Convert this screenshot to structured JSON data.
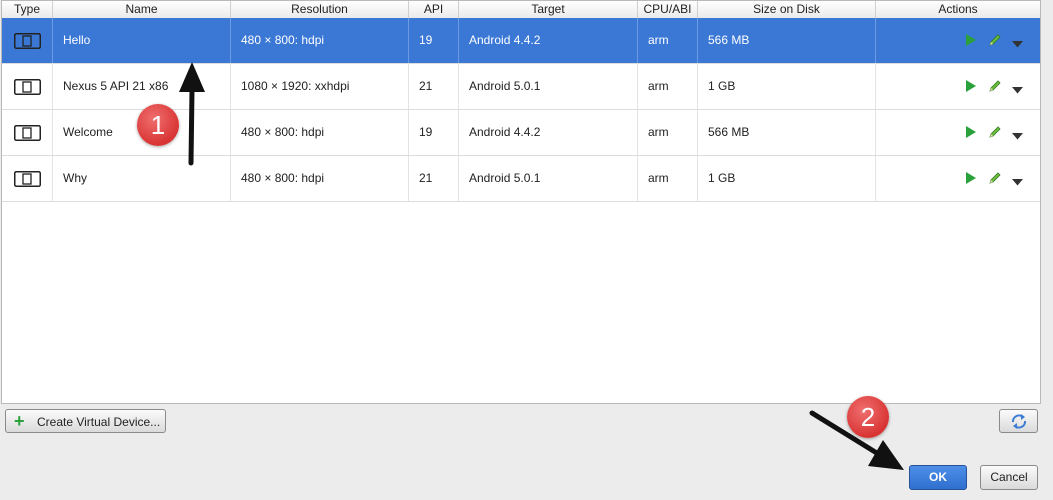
{
  "table": {
    "columns": [
      "Type",
      "Name",
      "Resolution",
      "API",
      "Target",
      "CPU/ABI",
      "Size on Disk",
      "Actions"
    ],
    "rows": [
      {
        "name": "Hello",
        "resolution": "480 × 800: hdpi",
        "api": "19",
        "target": "Android 4.4.2",
        "cpu": "arm",
        "size": "566 MB"
      },
      {
        "name": "Nexus 5 API 21 x86",
        "resolution": "1080 × 1920: xxhdpi",
        "api": "21",
        "target": "Android 5.0.1",
        "cpu": "arm",
        "size": "1 GB"
      },
      {
        "name": "Welcome",
        "resolution": "480 × 800: hdpi",
        "api": "19",
        "target": "Android 4.4.2",
        "cpu": "arm",
        "size": "566 MB"
      },
      {
        "name": "Why",
        "resolution": "480 × 800: hdpi",
        "api": "21",
        "target": "Android 5.0.1",
        "cpu": "arm",
        "size": "1 GB"
      }
    ],
    "selected_row": 0
  },
  "icons": {
    "device": "device-icon",
    "launch": "play-icon",
    "edit": "pencil-icon",
    "more": "dropdown-arrow-icon",
    "refresh": "refresh-icon",
    "create": "plus-icon"
  },
  "footer": {
    "create_label": "Create Virtual Device...",
    "ok_label": "OK",
    "cancel_label": "Cancel"
  },
  "annotations": {
    "step1": "1",
    "step2": "2"
  },
  "colors": {
    "selection": "#3b78d6",
    "play": "#2aa13a",
    "badge": "#d93434"
  }
}
